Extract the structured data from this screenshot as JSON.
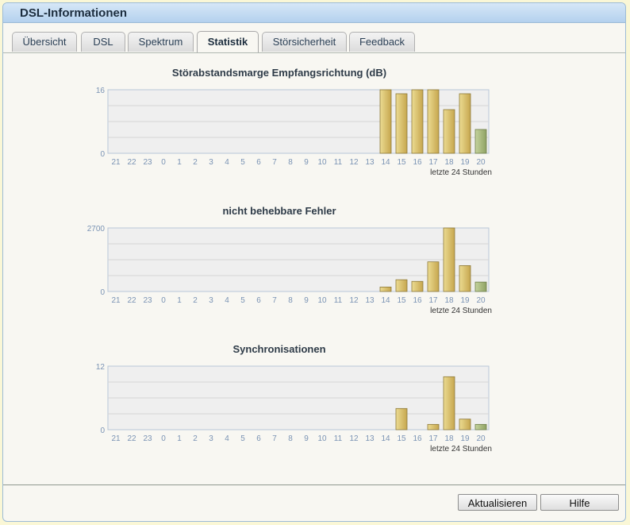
{
  "window": {
    "title": "DSL-Informationen"
  },
  "tabs": [
    {
      "label": "Übersicht",
      "active": false
    },
    {
      "label": "DSL",
      "active": false
    },
    {
      "label": "Spektrum",
      "active": false
    },
    {
      "label": "Statistik",
      "active": true
    },
    {
      "label": "Störsicherheit",
      "active": false
    },
    {
      "label": "Feedback",
      "active": false
    }
  ],
  "buttons": {
    "refresh_label": "Aktualisieren",
    "help_label": "Hilfe"
  },
  "colors": {
    "bar_gold_light": "#ecdc92",
    "bar_gold_dark": "#c6a64e",
    "bar_green_light": "#c5d39d",
    "bar_green_dark": "#8ea264",
    "plot_bg": "#efefef",
    "axis_text": "#7a93b4"
  },
  "chart_data": [
    {
      "type": "bar",
      "title": "Störabstandsmarge Empfangsrichtung (dB)",
      "xlabel": "letzte 24 Stunden",
      "ylim": [
        0,
        16
      ],
      "yticks": [
        "16",
        "0"
      ],
      "categories": [
        "21",
        "22",
        "23",
        "0",
        "1",
        "2",
        "3",
        "4",
        "5",
        "6",
        "7",
        "8",
        "9",
        "10",
        "11",
        "12",
        "13",
        "14",
        "15",
        "16",
        "17",
        "18",
        "19",
        "20"
      ],
      "values": [
        0,
        0,
        0,
        0,
        0,
        0,
        0,
        0,
        0,
        0,
        0,
        0,
        0,
        0,
        0,
        0,
        0,
        16,
        15,
        16,
        16,
        11,
        15,
        6
      ],
      "current_hour_highlight": "20"
    },
    {
      "type": "bar",
      "title": "nicht behebbare Fehler",
      "xlabel": "letzte 24 Stunden",
      "ylim": [
        0,
        2700
      ],
      "yticks": [
        "2700",
        "0"
      ],
      "categories": [
        "21",
        "22",
        "23",
        "0",
        "1",
        "2",
        "3",
        "4",
        "5",
        "6",
        "7",
        "8",
        "9",
        "10",
        "11",
        "12",
        "13",
        "14",
        "15",
        "16",
        "17",
        "18",
        "19",
        "20"
      ],
      "values": [
        0,
        0,
        0,
        0,
        0,
        0,
        0,
        0,
        0,
        0,
        0,
        0,
        0,
        0,
        0,
        0,
        0,
        190,
        500,
        430,
        1260,
        2700,
        1100,
        400
      ],
      "current_hour_highlight": "20"
    },
    {
      "type": "bar",
      "title": "Synchronisationen",
      "xlabel": "letzte 24 Stunden",
      "ylim": [
        0,
        12
      ],
      "yticks": [
        "12",
        "0"
      ],
      "categories": [
        "21",
        "22",
        "23",
        "0",
        "1",
        "2",
        "3",
        "4",
        "5",
        "6",
        "7",
        "8",
        "9",
        "10",
        "11",
        "12",
        "13",
        "14",
        "15",
        "16",
        "17",
        "18",
        "19",
        "20"
      ],
      "values": [
        0,
        0,
        0,
        0,
        0,
        0,
        0,
        0,
        0,
        0,
        0,
        0,
        0,
        0,
        0,
        0,
        0,
        0,
        4,
        0,
        1,
        10,
        2,
        1
      ],
      "current_hour_highlight": "20"
    }
  ]
}
